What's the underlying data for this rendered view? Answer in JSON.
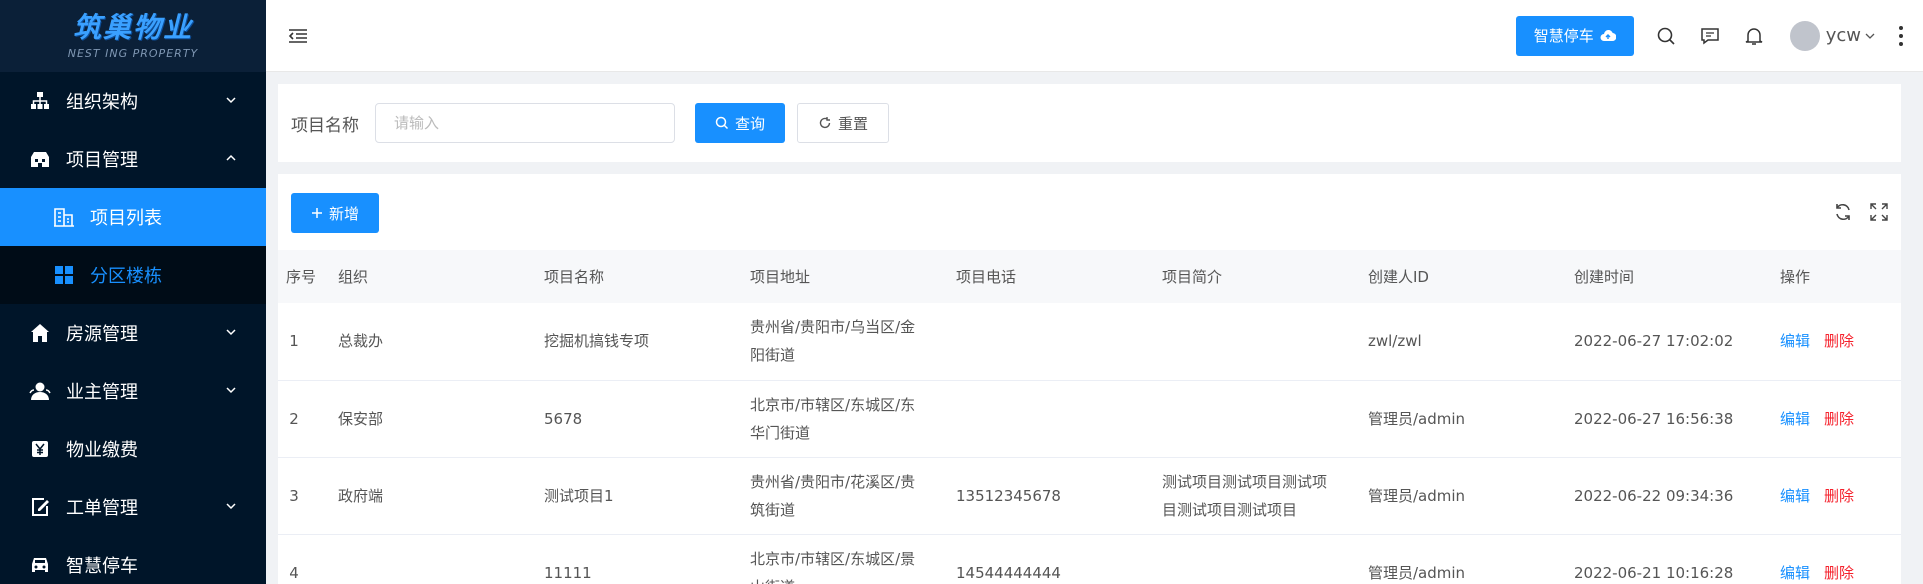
{
  "logo": {
    "main": "筑巢物业",
    "sub": "NEST ING PROPERTY"
  },
  "sidebar": {
    "items": [
      {
        "label": "组织架构",
        "icon": "org-chart-icon",
        "expanded": false
      },
      {
        "label": "项目管理",
        "icon": "building-icon",
        "expanded": true,
        "children": [
          {
            "label": "项目列表",
            "icon": "project-list-icon",
            "active": true
          },
          {
            "label": "分区楼栋",
            "icon": "grid-icon",
            "active": false
          }
        ]
      },
      {
        "label": "房源管理",
        "icon": "home-icon",
        "expanded": false
      },
      {
        "label": "业主管理",
        "icon": "user-group-icon",
        "expanded": false
      },
      {
        "label": "物业缴费",
        "icon": "yen-icon",
        "expanded": false
      },
      {
        "label": "工单管理",
        "icon": "edit-doc-icon",
        "expanded": false
      },
      {
        "label": "智慧停车",
        "icon": "car-icon",
        "expanded": false
      }
    ]
  },
  "header": {
    "parking_button": "智慧停车",
    "username": "ycw",
    "icons": [
      "menu-collapse-icon",
      "search-icon",
      "message-icon",
      "bell-icon",
      "more-icon"
    ]
  },
  "search": {
    "label": "项目名称",
    "placeholder": "请输入",
    "value": "",
    "query_button": "查询",
    "reset_button": "重置"
  },
  "toolbar": {
    "add_button": "新增"
  },
  "table": {
    "columns": [
      "序号",
      "组织",
      "项目名称",
      "项目地址",
      "项目电话",
      "项目简介",
      "创建人ID",
      "创建时间",
      "操作"
    ],
    "rows": [
      {
        "idx": "1",
        "org": "总裁办",
        "name": "挖掘机搞钱专项",
        "address": "贵州省/贵阳市/乌当区/金阳街道",
        "phone": "",
        "intro": "",
        "creator": "zwl/zwl",
        "created": "2022-06-27 17:02:02"
      },
      {
        "idx": "2",
        "org": "保安部",
        "name": "5678",
        "address": "北京市/市辖区/东城区/东华门街道",
        "phone": "",
        "intro": "",
        "creator": "管理员/admin",
        "created": "2022-06-27 16:56:38"
      },
      {
        "idx": "3",
        "org": "政府端",
        "name": "测试项目1",
        "address": "贵州省/贵阳市/花溪区/贵筑街道",
        "phone": "13512345678",
        "intro": "测试项目测试项目测试项目测试项目测试项目",
        "creator": "管理员/admin",
        "created": "2022-06-22 09:34:36"
      },
      {
        "idx": "4",
        "org": "",
        "name": "11111",
        "address": "北京市/市辖区/东城区/景山街道",
        "phone": "14544444444",
        "intro": "",
        "creator": "管理员/admin",
        "created": "2022-06-21 10:16:28"
      }
    ],
    "actions": {
      "edit": "编辑",
      "delete": "删除"
    }
  },
  "colors": {
    "primary": "#1890ff",
    "sidebar_bg": "#001529",
    "danger": "#f5222d"
  }
}
